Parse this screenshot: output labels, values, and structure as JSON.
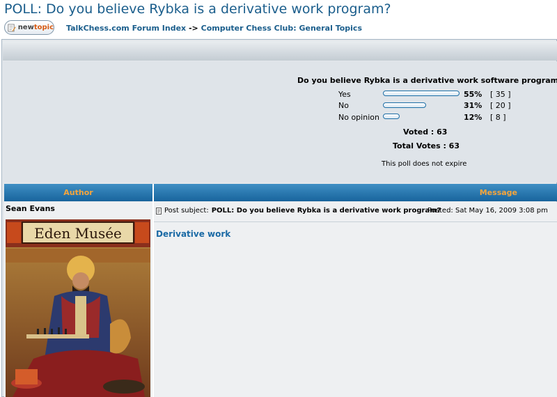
{
  "page": {
    "title": "POLL: Do you believe Rybka is a derivative work program?"
  },
  "toolbar": {
    "newtopic_new": "new",
    "newtopic_topic": "topic"
  },
  "breadcrumb": {
    "forum_index": "TalkChess.com Forum Index",
    "separator": "->",
    "section": "Computer Chess Club: General Topics"
  },
  "poll": {
    "question": "Do you believe Rybka is a derivative work software program?",
    "options": [
      {
        "label": "Yes",
        "percent": "55%",
        "count": "[ 35 ]",
        "fraction": 0.55
      },
      {
        "label": "No",
        "percent": "31%",
        "count": "[ 20 ]",
        "fraction": 0.31
      },
      {
        "label": "No opinion",
        "percent": "12%",
        "count": "[ 8 ]",
        "fraction": 0.12
      }
    ],
    "voted": "Voted : 63",
    "total_votes": "Total Votes : 63",
    "expire_note": "This poll does not expire"
  },
  "table": {
    "author_header": "Author",
    "message_header": "Message"
  },
  "post": {
    "author": "Sean Evans",
    "avatar_caption": "Eden Musée",
    "subject_label": "Post subject:",
    "subject": "POLL: Do you believe Rybka is a derivative work program?",
    "posted": "Posted: Sat May 16, 2009 3:08 pm",
    "body": "Derivative work"
  },
  "colors": {
    "title": "#1b5e8c",
    "header_bg": "#2a78b0",
    "header_text": "#f6a53c",
    "link": "#1b6aa5"
  }
}
